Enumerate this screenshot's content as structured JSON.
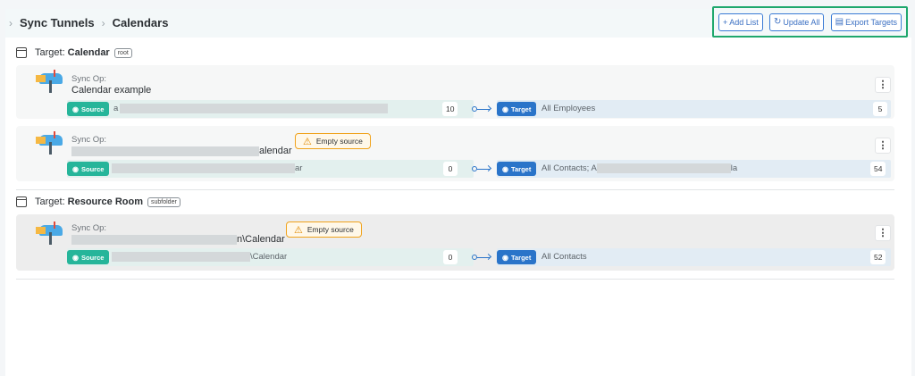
{
  "breadcrumb": {
    "root": "Sync Tunnels",
    "current": "Calendars"
  },
  "toolbar": {
    "add_list": "+ Add List",
    "update_all": "Update All",
    "export_targets": "Export Targets"
  },
  "labels": {
    "sync_op": "Sync Op:",
    "source": "Source",
    "target": "Target",
    "empty_source": "Empty source",
    "target_prefix": "Target:"
  },
  "targets": [
    {
      "name": "Calendar",
      "tag": "root",
      "ops": [
        {
          "name": "Calendar example",
          "source_visible": "a",
          "source_count": "10",
          "target_text": "All Employees",
          "target_count": "5"
        },
        {
          "name_suffix": "alendar",
          "source_suffix": "ar",
          "source_count": "0",
          "target_text": "All Contacts; A",
          "target_suffix": "la",
          "target_count": "54"
        }
      ]
    },
    {
      "name": "Resource Room",
      "tag": "subfolder",
      "ops": [
        {
          "name_suffix": "n\\Calendar",
          "source_suffix": "\\Calendar",
          "source_count": "0",
          "target_text": "All Contacts",
          "target_count": "52"
        }
      ]
    }
  ],
  "colors": {
    "accent_green": "#1fa86d",
    "source_pill": "#26b59a",
    "target_pill": "#2a74c9",
    "warning": "#f0a21b"
  }
}
